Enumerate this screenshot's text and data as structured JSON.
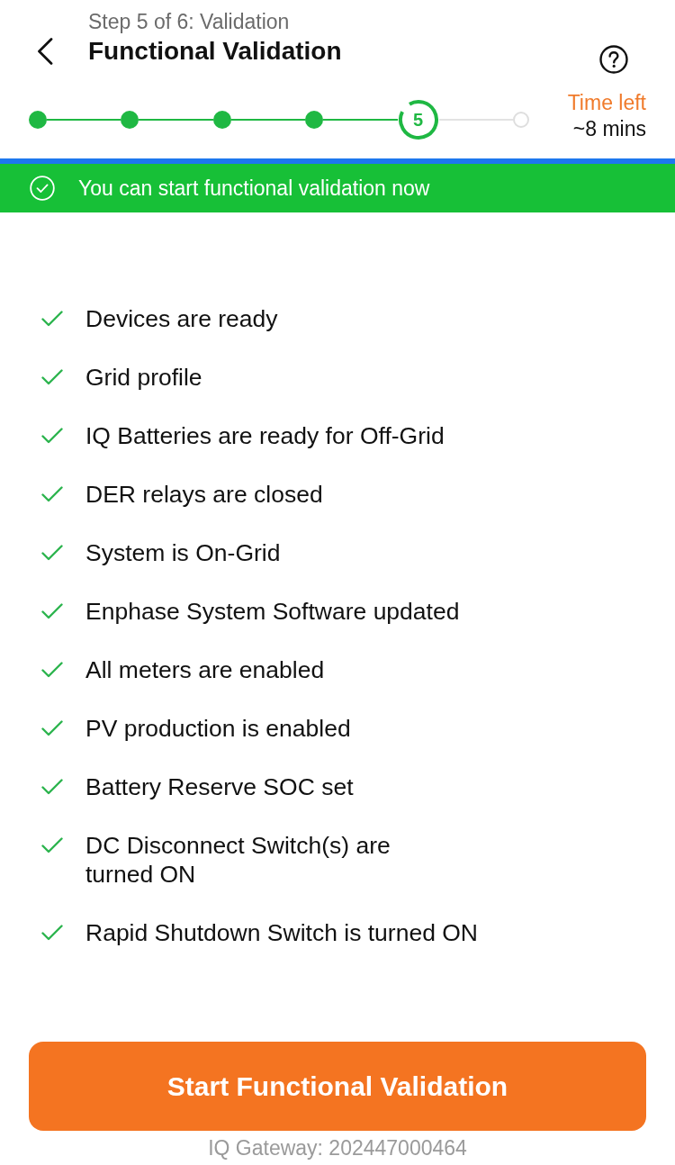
{
  "header": {
    "step_label": "Step 5 of 6: Validation",
    "title": "Functional Validation"
  },
  "stepper": {
    "steps": [
      {
        "kind": "done"
      },
      {
        "kind": "done"
      },
      {
        "kind": "done"
      },
      {
        "kind": "done"
      },
      {
        "kind": "current",
        "label": "5",
        "level": 0.9
      },
      {
        "kind": "pending"
      }
    ],
    "time_left_label": "Time left",
    "time_left_value": "~8 mins"
  },
  "banner": {
    "text": "You can start functional validation now"
  },
  "checklist": [
    {
      "text": "Devices are ready",
      "checked": true
    },
    {
      "text": "Grid profile",
      "checked": true
    },
    {
      "text": "IQ Batteries are ready for Off-Grid",
      "checked": true
    },
    {
      "text": "DER relays are closed",
      "checked": true
    },
    {
      "text": "System is On-Grid",
      "checked": true
    },
    {
      "text": "Enphase System Software updated",
      "checked": true
    },
    {
      "text": "All meters are enabled",
      "checked": true
    },
    {
      "text": "PV production is enabled",
      "checked": true
    },
    {
      "text": "Battery Reserve SOC set",
      "checked": true
    },
    {
      "text": "DC Disconnect Switch(s) are\nturned ON",
      "checked": true
    },
    {
      "text": "Rapid Shutdown Switch is turned ON",
      "checked": true
    }
  ],
  "primary_button": {
    "label": "Start Functional Validation"
  },
  "footer": {
    "text": "IQ Gateway: 202447000464"
  }
}
